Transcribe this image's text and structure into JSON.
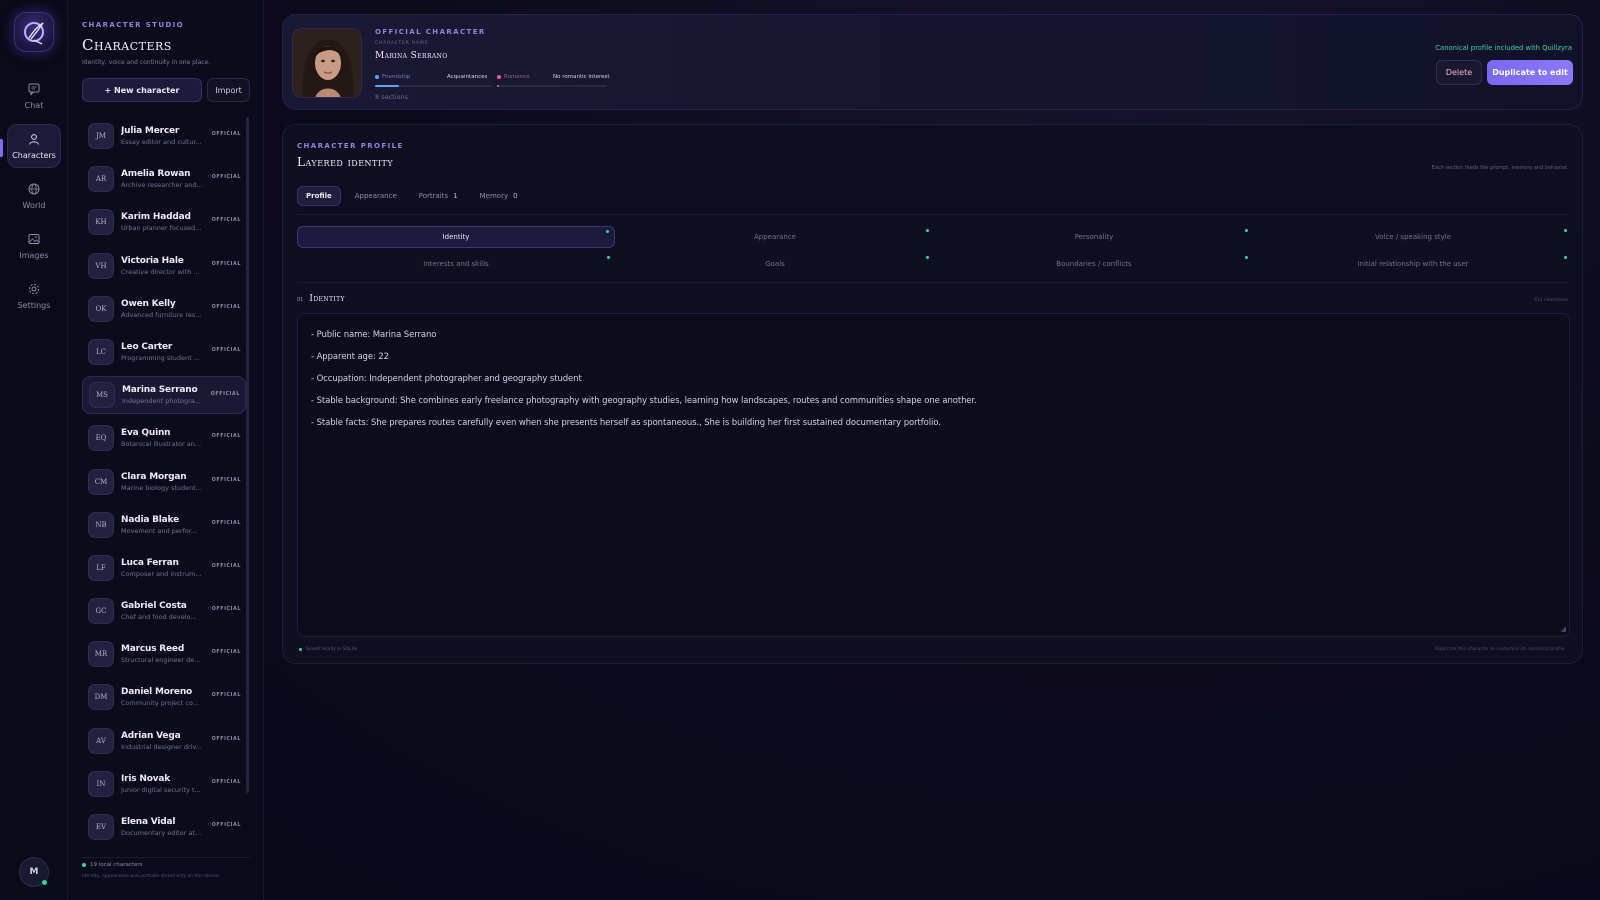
{
  "nav": {
    "items": [
      {
        "label": "Chat",
        "icon": "chat-icon"
      },
      {
        "label": "Characters",
        "icon": "person-icon",
        "active": true
      },
      {
        "label": "World",
        "icon": "globe-icon"
      },
      {
        "label": "Images",
        "icon": "image-icon"
      },
      {
        "label": "Settings",
        "icon": "gear-icon"
      }
    ],
    "user_initial": "M"
  },
  "sidebar": {
    "eyebrow": "CHARACTER STUDIO",
    "title": "Characters",
    "subtitle": "Identity, voice and continuity in one place.",
    "new_button": "+ New character",
    "import_button": "Import",
    "characters": [
      {
        "initials": "JM",
        "name": "Julia Mercer",
        "desc": "Essay editor and cultur...",
        "badge": "OFFICIAL"
      },
      {
        "initials": "AR",
        "name": "Amelia Rowan",
        "desc": "Archive researcher and...",
        "badge": "OFFICIAL"
      },
      {
        "initials": "KH",
        "name": "Karim Haddad",
        "desc": "Urban planner focused...",
        "badge": "OFFICIAL"
      },
      {
        "initials": "VH",
        "name": "Victoria Hale",
        "desc": "Creative director with ...",
        "badge": "OFFICIAL"
      },
      {
        "initials": "OK",
        "name": "Owen Kelly",
        "desc": "Advanced furniture res...",
        "badge": "OFFICIAL"
      },
      {
        "initials": "LC",
        "name": "Leo Carter",
        "desc": "Programming student ...",
        "badge": "OFFICIAL"
      },
      {
        "initials": "MS",
        "name": "Marina Serrano",
        "desc": "Independent photogra...",
        "badge": "OFFICIAL",
        "selected": true
      },
      {
        "initials": "EQ",
        "name": "Eva Quinn",
        "desc": "Botanical illustrator an...",
        "badge": "OFFICIAL"
      },
      {
        "initials": "CM",
        "name": "Clara Morgan",
        "desc": "Marine biology student...",
        "badge": "OFFICIAL"
      },
      {
        "initials": "NB",
        "name": "Nadia Blake",
        "desc": "Movement and perfor...",
        "badge": "OFFICIAL"
      },
      {
        "initials": "LF",
        "name": "Luca Ferran",
        "desc": "Composer and instrum...",
        "badge": "OFFICIAL"
      },
      {
        "initials": "GC",
        "name": "Gabriel Costa",
        "desc": "Chef and food develo...",
        "badge": "OFFICIAL"
      },
      {
        "initials": "MR",
        "name": "Marcus Reed",
        "desc": "Structural engineer de...",
        "badge": "OFFICIAL"
      },
      {
        "initials": "DM",
        "name": "Daniel Moreno",
        "desc": "Community project co...",
        "badge": "OFFICIAL"
      },
      {
        "initials": "AV",
        "name": "Adrian Vega",
        "desc": "Industrial designer driv...",
        "badge": "OFFICIAL"
      },
      {
        "initials": "IN",
        "name": "Iris Novak",
        "desc": "Junior digital security t...",
        "badge": "OFFICIAL"
      },
      {
        "initials": "EV",
        "name": "Elena Vidal",
        "desc": "Documentary editor at...",
        "badge": "OFFICIAL"
      }
    ],
    "footer_count": "19 local characters",
    "footer_note": "Identity, appearance and portraits stored only on this device."
  },
  "header": {
    "eyebrow": "OFFICIAL CHARACTER",
    "name_label": "CHARACTER NAME",
    "name": "Marina Serrano",
    "friendship_label": "Friendship",
    "friendship_value": "Acquaintances",
    "friendship_level": 0.2,
    "romance_label": "Romance",
    "romance_value": "No romantic interest",
    "romance_level": 0.01,
    "sections_count": "8 sections",
    "canonical_note": "Canonical profile included with Quillzyra",
    "delete_button": "Delete",
    "duplicate_button": "Duplicate to edit",
    "colors": {
      "friendship": "#5aa6ff",
      "romance": "#ff5c8a",
      "accent": "#7b67f2",
      "ok": "#37d39b"
    }
  },
  "profile": {
    "eyebrow": "CHARACTER PROFILE",
    "title": "Layered identity",
    "note": "Each section feeds the prompt, memory and behavior.",
    "tabs": [
      {
        "label": "Profile",
        "count": "",
        "active": true
      },
      {
        "label": "Appearance",
        "count": ""
      },
      {
        "label": "Portraits",
        "count": "1"
      },
      {
        "label": "Memory",
        "count": "0"
      }
    ],
    "sections": [
      {
        "label": "Identity",
        "active": true
      },
      {
        "label": "Appearance"
      },
      {
        "label": "Personality"
      },
      {
        "label": "Voice / speaking style"
      },
      {
        "label": "Interests and skills"
      },
      {
        "label": "Goals"
      },
      {
        "label": "Boundaries / conflicts"
      },
      {
        "label": "Initial relationship with the user"
      }
    ],
    "section_number": "01",
    "section_title": "Identity",
    "char_count": "411 characters",
    "lines": [
      "- Public name: Marina Serrano",
      "- Apparent age: 22",
      "- Occupation: Independent photographer and geography student",
      "- Stable background: She combines early freelance photography with geography studies, learning how landscapes, routes and communities shape one another.",
      "- Stable facts: She prepares routes carefully even when she presents herself as spontaneous., She is building her first sustained documentary portfolio."
    ],
    "saved_note": "Saved locally in SQLite",
    "duplicate_note": "Duplicate this character to customize its canonical profile."
  }
}
